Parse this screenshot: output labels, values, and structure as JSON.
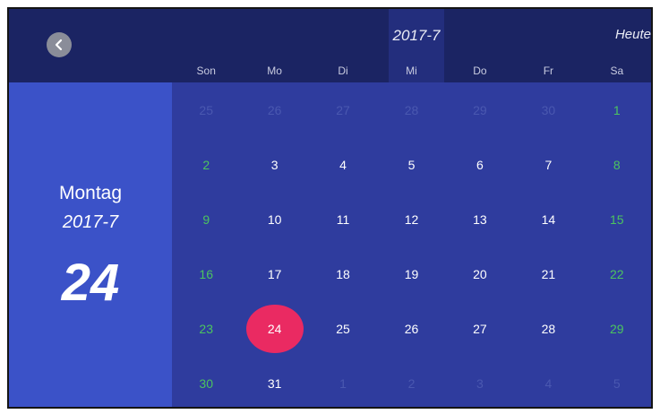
{
  "header": {
    "month_title": "2017-7",
    "today_label": "Heute"
  },
  "weekdays": [
    "Son",
    "Mo",
    "Di",
    "Mi",
    "Do",
    "Fr",
    "Sa"
  ],
  "sidebar": {
    "day_name": "Montag",
    "month": "2017-7",
    "day": "24"
  },
  "calendar": {
    "weeks": [
      [
        {
          "d": "25",
          "t": "other"
        },
        {
          "d": "26",
          "t": "other"
        },
        {
          "d": "27",
          "t": "other"
        },
        {
          "d": "28",
          "t": "other"
        },
        {
          "d": "29",
          "t": "other"
        },
        {
          "d": "30",
          "t": "other"
        },
        {
          "d": "1",
          "t": "weekend"
        }
      ],
      [
        {
          "d": "2",
          "t": "weekend"
        },
        {
          "d": "3",
          "t": "normal"
        },
        {
          "d": "4",
          "t": "normal"
        },
        {
          "d": "5",
          "t": "normal"
        },
        {
          "d": "6",
          "t": "normal"
        },
        {
          "d": "7",
          "t": "normal"
        },
        {
          "d": "8",
          "t": "weekend"
        }
      ],
      [
        {
          "d": "9",
          "t": "weekend"
        },
        {
          "d": "10",
          "t": "normal"
        },
        {
          "d": "11",
          "t": "normal"
        },
        {
          "d": "12",
          "t": "normal"
        },
        {
          "d": "13",
          "t": "normal"
        },
        {
          "d": "14",
          "t": "normal"
        },
        {
          "d": "15",
          "t": "weekend"
        }
      ],
      [
        {
          "d": "16",
          "t": "weekend"
        },
        {
          "d": "17",
          "t": "normal"
        },
        {
          "d": "18",
          "t": "normal"
        },
        {
          "d": "19",
          "t": "normal"
        },
        {
          "d": "20",
          "t": "normal"
        },
        {
          "d": "21",
          "t": "normal"
        },
        {
          "d": "22",
          "t": "weekend"
        }
      ],
      [
        {
          "d": "23",
          "t": "weekend"
        },
        {
          "d": "24",
          "t": "selected"
        },
        {
          "d": "25",
          "t": "normal"
        },
        {
          "d": "26",
          "t": "normal"
        },
        {
          "d": "27",
          "t": "normal"
        },
        {
          "d": "28",
          "t": "normal"
        },
        {
          "d": "29",
          "t": "weekend"
        }
      ],
      [
        {
          "d": "30",
          "t": "weekend"
        },
        {
          "d": "31",
          "t": "normal"
        },
        {
          "d": "1",
          "t": "other"
        },
        {
          "d": "2",
          "t": "other"
        },
        {
          "d": "3",
          "t": "other"
        },
        {
          "d": "4",
          "t": "other"
        },
        {
          "d": "5",
          "t": "other"
        }
      ]
    ]
  },
  "icons": {
    "back": "chevron-left-icon"
  },
  "colors": {
    "header_bg": "#1b2463",
    "grid_bg": "#2f3c9e",
    "sidebar_bg": "#3b52c8",
    "weekend_text": "#4cc45f",
    "selected_bg": "#ea2a62"
  }
}
